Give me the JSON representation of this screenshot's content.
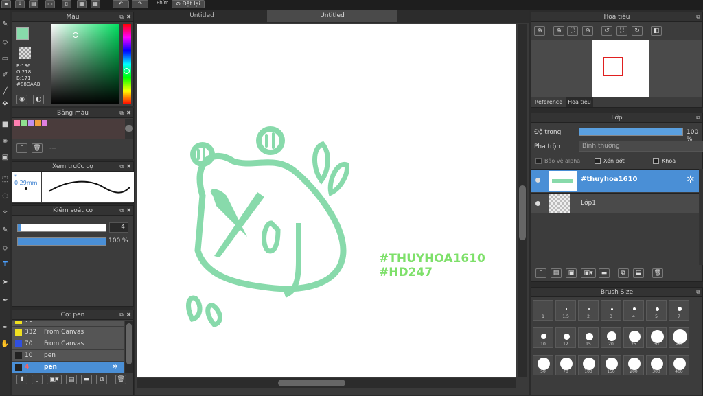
{
  "toolbar": {
    "phim_label": "Phím",
    "reset_label": "Đặt lại"
  },
  "color_panel": {
    "title": "Màu",
    "r": "R:136",
    "g": "G:218",
    "b": "B:171",
    "hex": "#88DAAB",
    "fg_color": "#88DAAB"
  },
  "palette_panel": {
    "title": "Bảng màu",
    "value": "---",
    "swatches": [
      "#ff7fb0",
      "#8fe08f",
      "#c090f0",
      "#f0a040",
      "#e080e0"
    ]
  },
  "preview_panel": {
    "title": "Xem trước cọ",
    "size": "* 0.29mm"
  },
  "brush_ctrl": {
    "title": "Kiểm soát cọ",
    "size_value": "4",
    "opacity_value": "100 %"
  },
  "brush_list": {
    "title": "Cọ: pen",
    "items": [
      {
        "num": "70",
        "name": "",
        "color": "#f0e020"
      },
      {
        "num": "332",
        "name": "From Canvas",
        "color": "#f0e020"
      },
      {
        "num": "70",
        "name": "From Canvas",
        "color": "#3050e0"
      },
      {
        "num": "10",
        "name": "pen",
        "color": "#222222"
      },
      {
        "num": "4",
        "name": "pen",
        "color": "#222222"
      }
    ]
  },
  "canvas": {
    "tabs": [
      "Untitled",
      "Untitled"
    ],
    "line1": "#THUYHOA1610",
    "line2": "#HD247",
    "art_color": "#88DAAB",
    "text_color": "#7ee06a"
  },
  "navigator": {
    "title": "Hoa tiêu",
    "tab_reference": "Reference",
    "tab_nav": "Hoa tiêu"
  },
  "layer_panel": {
    "title": "Lớp",
    "opacity_label": "Độ trong",
    "opacity_value": "100 %",
    "blend_label": "Pha trộn",
    "blend_value": "Bình thường",
    "protect_alpha": "Bảo vệ alpha",
    "clip": "Xén bớt",
    "lock": "Khóa",
    "layers": [
      {
        "name": "#thuyhoa1610"
      },
      {
        "name": "Lớp1"
      }
    ]
  },
  "brush_size": {
    "title": "Brush Size",
    "sizes": [
      "1",
      "1.5",
      "2",
      "3",
      "4",
      "5",
      "7",
      "10",
      "12",
      "15",
      "20",
      "25",
      "30",
      "40",
      "50",
      "70",
      "100",
      "150",
      "200",
      "300",
      "400"
    ]
  }
}
